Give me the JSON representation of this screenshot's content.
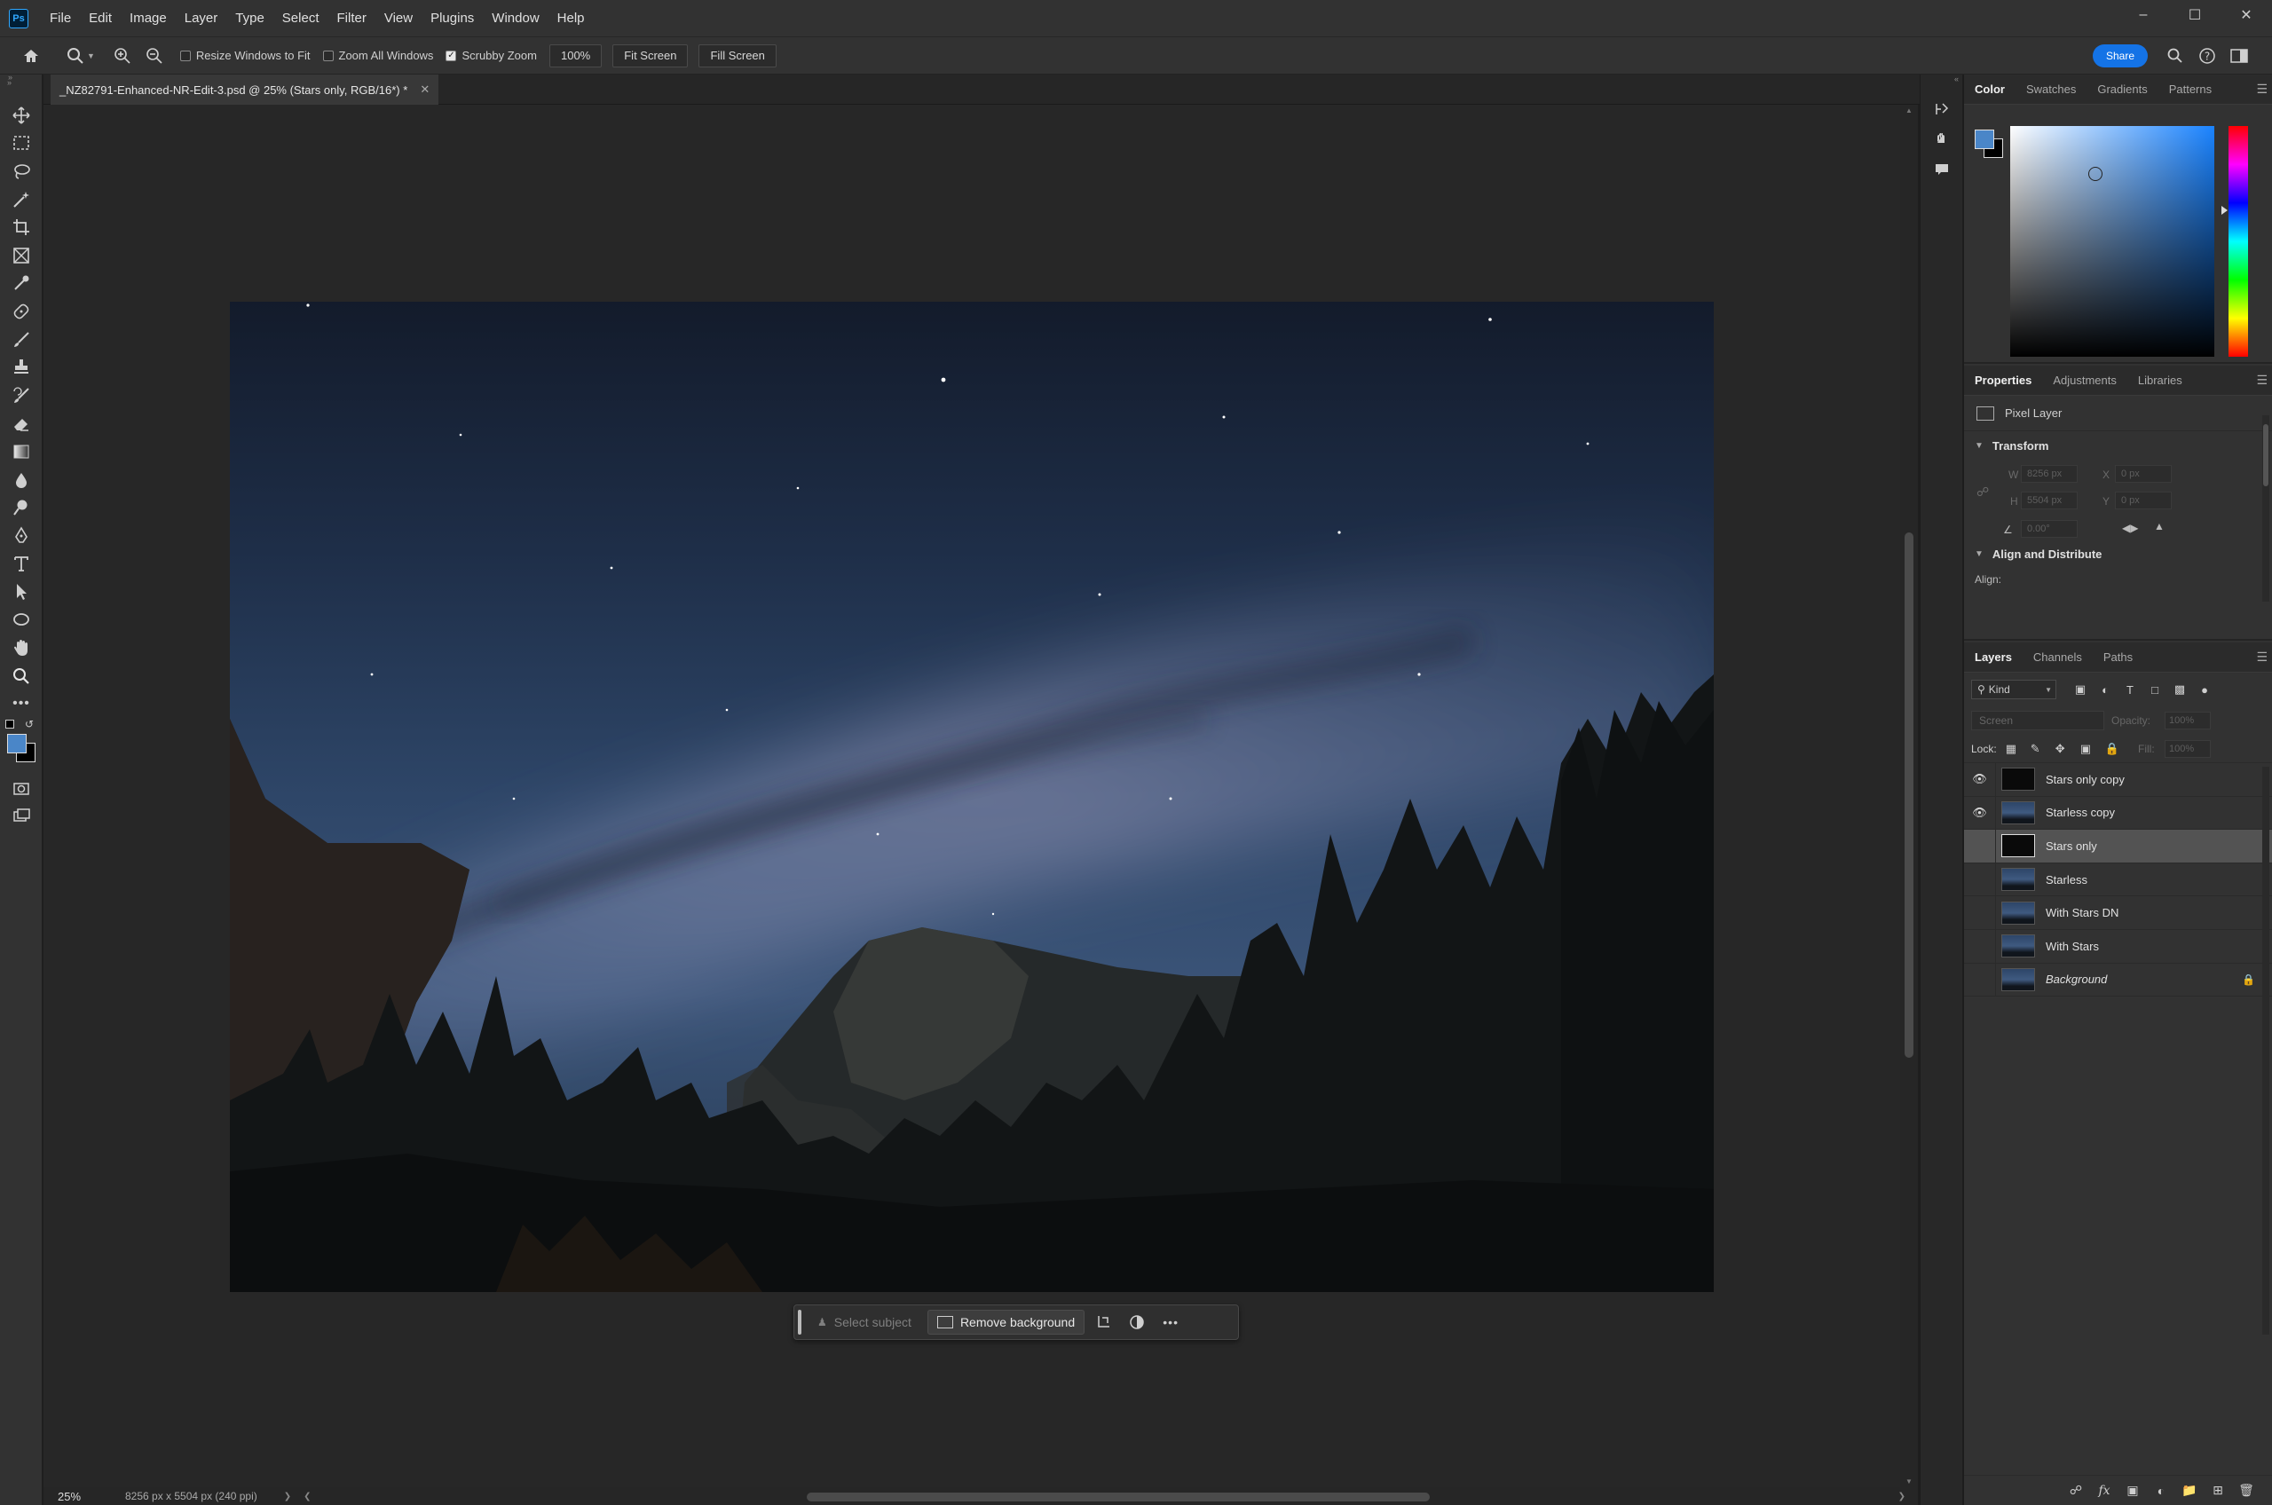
{
  "app": {
    "logo_text": "Ps"
  },
  "menu": [
    "File",
    "Edit",
    "Image",
    "Layer",
    "Type",
    "Select",
    "Filter",
    "View",
    "Plugins",
    "Window",
    "Help"
  ],
  "options": {
    "resize_windows": "Resize Windows to Fit",
    "zoom_all_windows": "Zoom All Windows",
    "scrubby_zoom": "Scrubby Zoom",
    "zoom_value": "100%",
    "fit_screen": "Fit Screen",
    "fill_screen": "Fill Screen",
    "share": "Share"
  },
  "document": {
    "tab_title": "_NZ82791-Enhanced-NR-Edit-3.psd @ 25% (Stars only, RGB/16*) *"
  },
  "taskbar": {
    "select_subject": "Select subject",
    "remove_background": "Remove background"
  },
  "status": {
    "zoom": "25%",
    "info": "8256 px x 5504 px (240 ppi)"
  },
  "color_panel": {
    "tabs": [
      "Color",
      "Swatches",
      "Gradients",
      "Patterns"
    ],
    "foreground": "#4a86c8",
    "background": "#000000"
  },
  "properties_panel": {
    "tabs": [
      "Properties",
      "Adjustments",
      "Libraries"
    ],
    "layer_type": "Pixel Layer",
    "transform_title": "Transform",
    "w_label": "W",
    "w_value": "8256 px",
    "x_label": "X",
    "x_value": "0 px",
    "h_label": "H",
    "h_value": "5504 px",
    "y_label": "Y",
    "y_value": "0 px",
    "angle_value": "0.00°",
    "align_title": "Align and Distribute",
    "align_label": "Align:"
  },
  "layers_panel": {
    "tabs": [
      "Layers",
      "Channels",
      "Paths"
    ],
    "kind": "Kind",
    "blend_mode": "Screen",
    "opacity_label": "Opacity:",
    "opacity_value": "100%",
    "lock_label": "Lock:",
    "fill_label": "Fill:",
    "fill_value": "100%",
    "layers": [
      {
        "name": "Stars only copy",
        "visible": true,
        "thumb": "dark"
      },
      {
        "name": "Starless copy",
        "visible": true,
        "thumb": "sky"
      },
      {
        "name": "Stars only",
        "visible": false,
        "thumb": "dark",
        "selected": true
      },
      {
        "name": "Starless",
        "visible": false,
        "thumb": "sky"
      },
      {
        "name": "With Stars DN",
        "visible": false,
        "thumb": "sky"
      },
      {
        "name": "With Stars",
        "visible": false,
        "thumb": "sky"
      },
      {
        "name": "Background",
        "visible": false,
        "thumb": "sky",
        "locked": true
      }
    ]
  }
}
